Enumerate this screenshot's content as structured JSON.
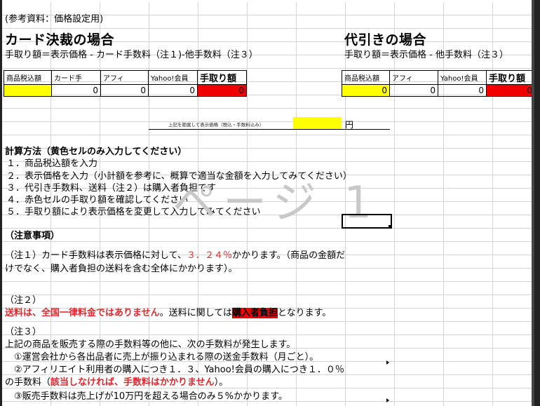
{
  "header": {
    "reference": "(参考資料：価格設定用)"
  },
  "card": {
    "title": "カード決裁の場合",
    "formula": "手取り額＝表示価格 - カード手数料（注１)-他手数料（注３）",
    "columns": [
      "商品税込額",
      "カード手",
      "アフィ",
      "Yahoo!会員",
      "手取り額"
    ],
    "values": [
      "",
      "0",
      "0",
      "0",
      "0"
    ]
  },
  "cod": {
    "title": "代引きの場合",
    "formula": "手取り額＝表示価格 - 他手数料（注３）",
    "columns": [
      "商品税込額",
      "アフィ",
      "Yahoo!会員",
      "手取り額"
    ],
    "values": [
      "0",
      "0",
      "0",
      "0"
    ]
  },
  "display_price": {
    "label": "上記を勘案して表示価格（税込・手数料込み）",
    "unit": "円"
  },
  "method": {
    "title": "計算方法（黄色セルのみ入力してください）",
    "steps": [
      "１．商品税込額を入力",
      "２．表示価格を入力（小計額を参考に、概算で適当な金額を入力してみてください）",
      "３．代引き手数料、送料（注２）は購入者負担です",
      "４．赤色セルの手取り額を確認してください",
      "５．手取り額により表示価格を変更して入力してみてください"
    ]
  },
  "watermark": "ページ 1",
  "notes": {
    "title": "（注意事項）",
    "note1": {
      "line1_a": "（注１）カード手数料は表示価格に対して、",
      "line1_red": "３．２４％",
      "line1_b": "かかります。（商品の金額だ",
      "line2": "けでなく、購入者負担の送料を含む全体にかかります）。"
    },
    "note2": {
      "label": "（注２）",
      "red1": "送料は、全国一律料金ではありません",
      "mid": "。送料に関しては",
      "red2": "購入者負担",
      "end": "となります。"
    },
    "note3": {
      "label": "（注３）",
      "line1": "上記の商品を販売する際の手数料等の他に、次の手数料が発生します。",
      "line2": "①運営会社から各出品者に売上が振り込まれる際の送金手数料（月ごと）。",
      "line3": "②アフィリエイト利用者の購入につき１．３、Yahoo!会員の購入につき１．０％",
      "line4_a": "の手数料（",
      "line4_red": "該当しなければ、手数料はかかりません",
      "line4_b": "）。",
      "line5": "③販売手数料は売上げが10万円を超える場合のみ５%かかります。"
    }
  }
}
